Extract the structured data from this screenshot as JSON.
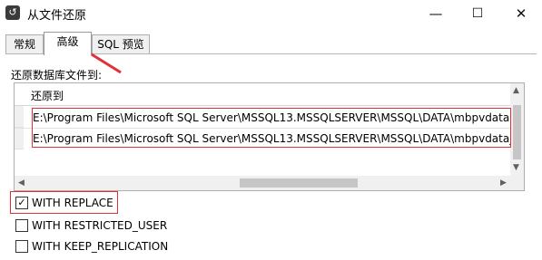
{
  "window": {
    "title": "从文件还原",
    "icon": "restore-app-icon",
    "controls": {
      "minimize": "—",
      "maximize": "☐",
      "close": "✕"
    }
  },
  "tabs": [
    {
      "label": "常规",
      "active": false
    },
    {
      "label": "高级",
      "active": true
    },
    {
      "label": "SQL 预览",
      "active": false
    }
  ],
  "section": {
    "label": "还原数据库文件到:"
  },
  "grid": {
    "header": "还原到",
    "rows": [
      "E:\\Program Files\\Microsoft SQL Server\\MSSQL13.MSSQLSERVER\\MSSQL\\DATA\\mbpvdata.mdf",
      "E:\\Program Files\\Microsoft SQL Server\\MSSQL13.MSSQLSERVER\\MSSQL\\DATA\\mbpvdata_log.ldf"
    ]
  },
  "options": [
    {
      "label": "WITH REPLACE",
      "checked": true
    },
    {
      "label": "WITH RESTRICTED_USER",
      "checked": false
    },
    {
      "label": "WITH KEEP_REPLICATION",
      "checked": false
    }
  ],
  "colors": {
    "highlight": "#e0303a",
    "annotation_arrow": "#e0303a"
  }
}
